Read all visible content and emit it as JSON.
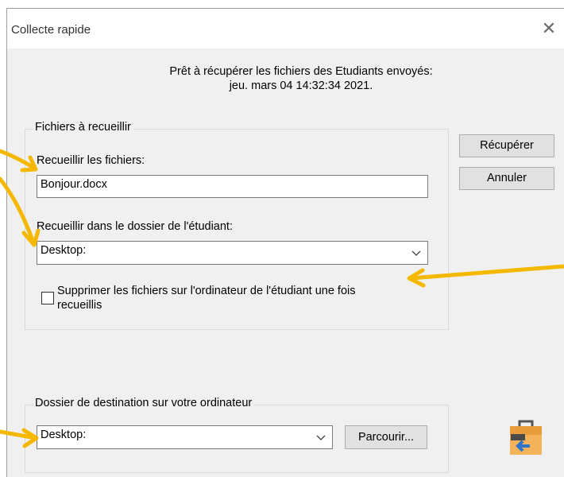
{
  "window": {
    "title": "Collecte rapide",
    "close_glyph": "✕"
  },
  "message": {
    "line1": "Prêt à récupérer les fichiers des Etudiants envoyés:",
    "line2": "jeu. mars 04 14:32:34 2021."
  },
  "collect_group": {
    "legend": "Fichiers à recueillir",
    "files_label": "Recueillir les fichiers:",
    "files_value": "Bonjour.docx",
    "folder_label": "Recueillir dans le dossier de l'étudiant:",
    "folder_value": "Desktop:",
    "delete_checkbox_label_line1": "Supprimer les fichiers sur l'ordinateur de l'étudiant une fois",
    "delete_checkbox_label_line2": "recueillis",
    "delete_checked": false
  },
  "destination_group": {
    "legend": "Dossier de destination sur votre ordinateur",
    "folder_value": "Desktop:",
    "browse_label": "Parcourir..."
  },
  "buttons": {
    "retrieve": "Récupérer",
    "cancel": "Annuler"
  },
  "icons": {
    "app_icon": "briefcase-arrow-icon",
    "close": "close-icon",
    "dropdown": "chevron-down-icon"
  },
  "colors": {
    "annotation_arrow": "#f5b800",
    "dialog_bg": "#f0f0f0"
  }
}
